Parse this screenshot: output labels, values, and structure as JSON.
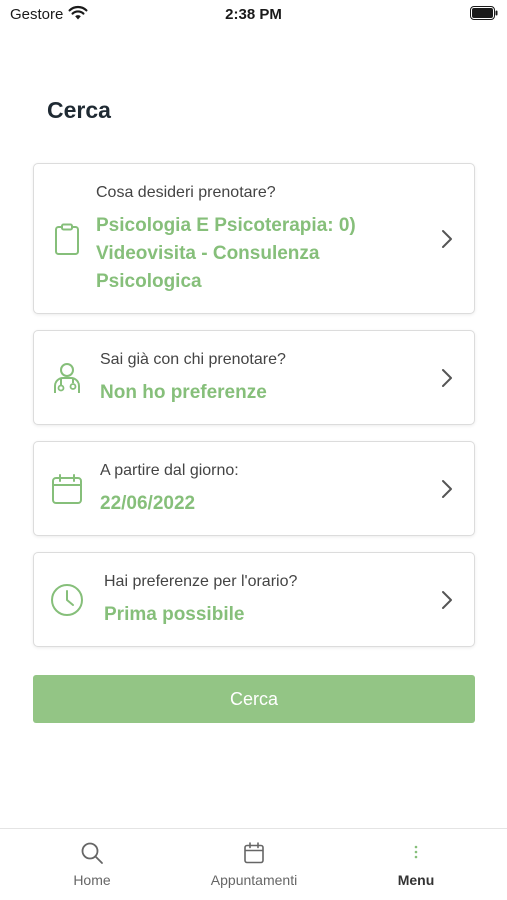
{
  "status_bar": {
    "carrier": "Gestore",
    "time": "2:38 PM",
    "wifi_icon": "wifi-icon",
    "battery_icon": "battery-icon"
  },
  "page": {
    "title": "Cerca"
  },
  "cards": [
    {
      "icon": "clipboard-icon",
      "label": "Cosa desideri prenotare?",
      "value_lines": [
        "Psicologia E Psicoterapia: 0)",
        "Videovisita - Consulenza",
        "Psicologica"
      ]
    },
    {
      "icon": "doctor-icon",
      "label": "Sai già con chi prenotare?",
      "value": "Non ho preferenze"
    },
    {
      "icon": "calendar-icon",
      "label": "A partire dal giorno:",
      "value": "22/06/2022"
    },
    {
      "icon": "clock-icon",
      "label": "Hai preferenze per l'orario?",
      "value": "Prima possibile"
    }
  ],
  "search_button": {
    "label": "Cerca"
  },
  "tab_bar": {
    "tabs": [
      {
        "label": "Home",
        "icon": "search-icon"
      },
      {
        "label": "Appuntamenti",
        "icon": "calendar-icon"
      },
      {
        "label": "Menu",
        "icon": "more-vertical-icon",
        "active": true
      }
    ]
  },
  "colors": {
    "accent": "#86bf7a",
    "button": "#93c585",
    "title": "#1f2a33"
  }
}
